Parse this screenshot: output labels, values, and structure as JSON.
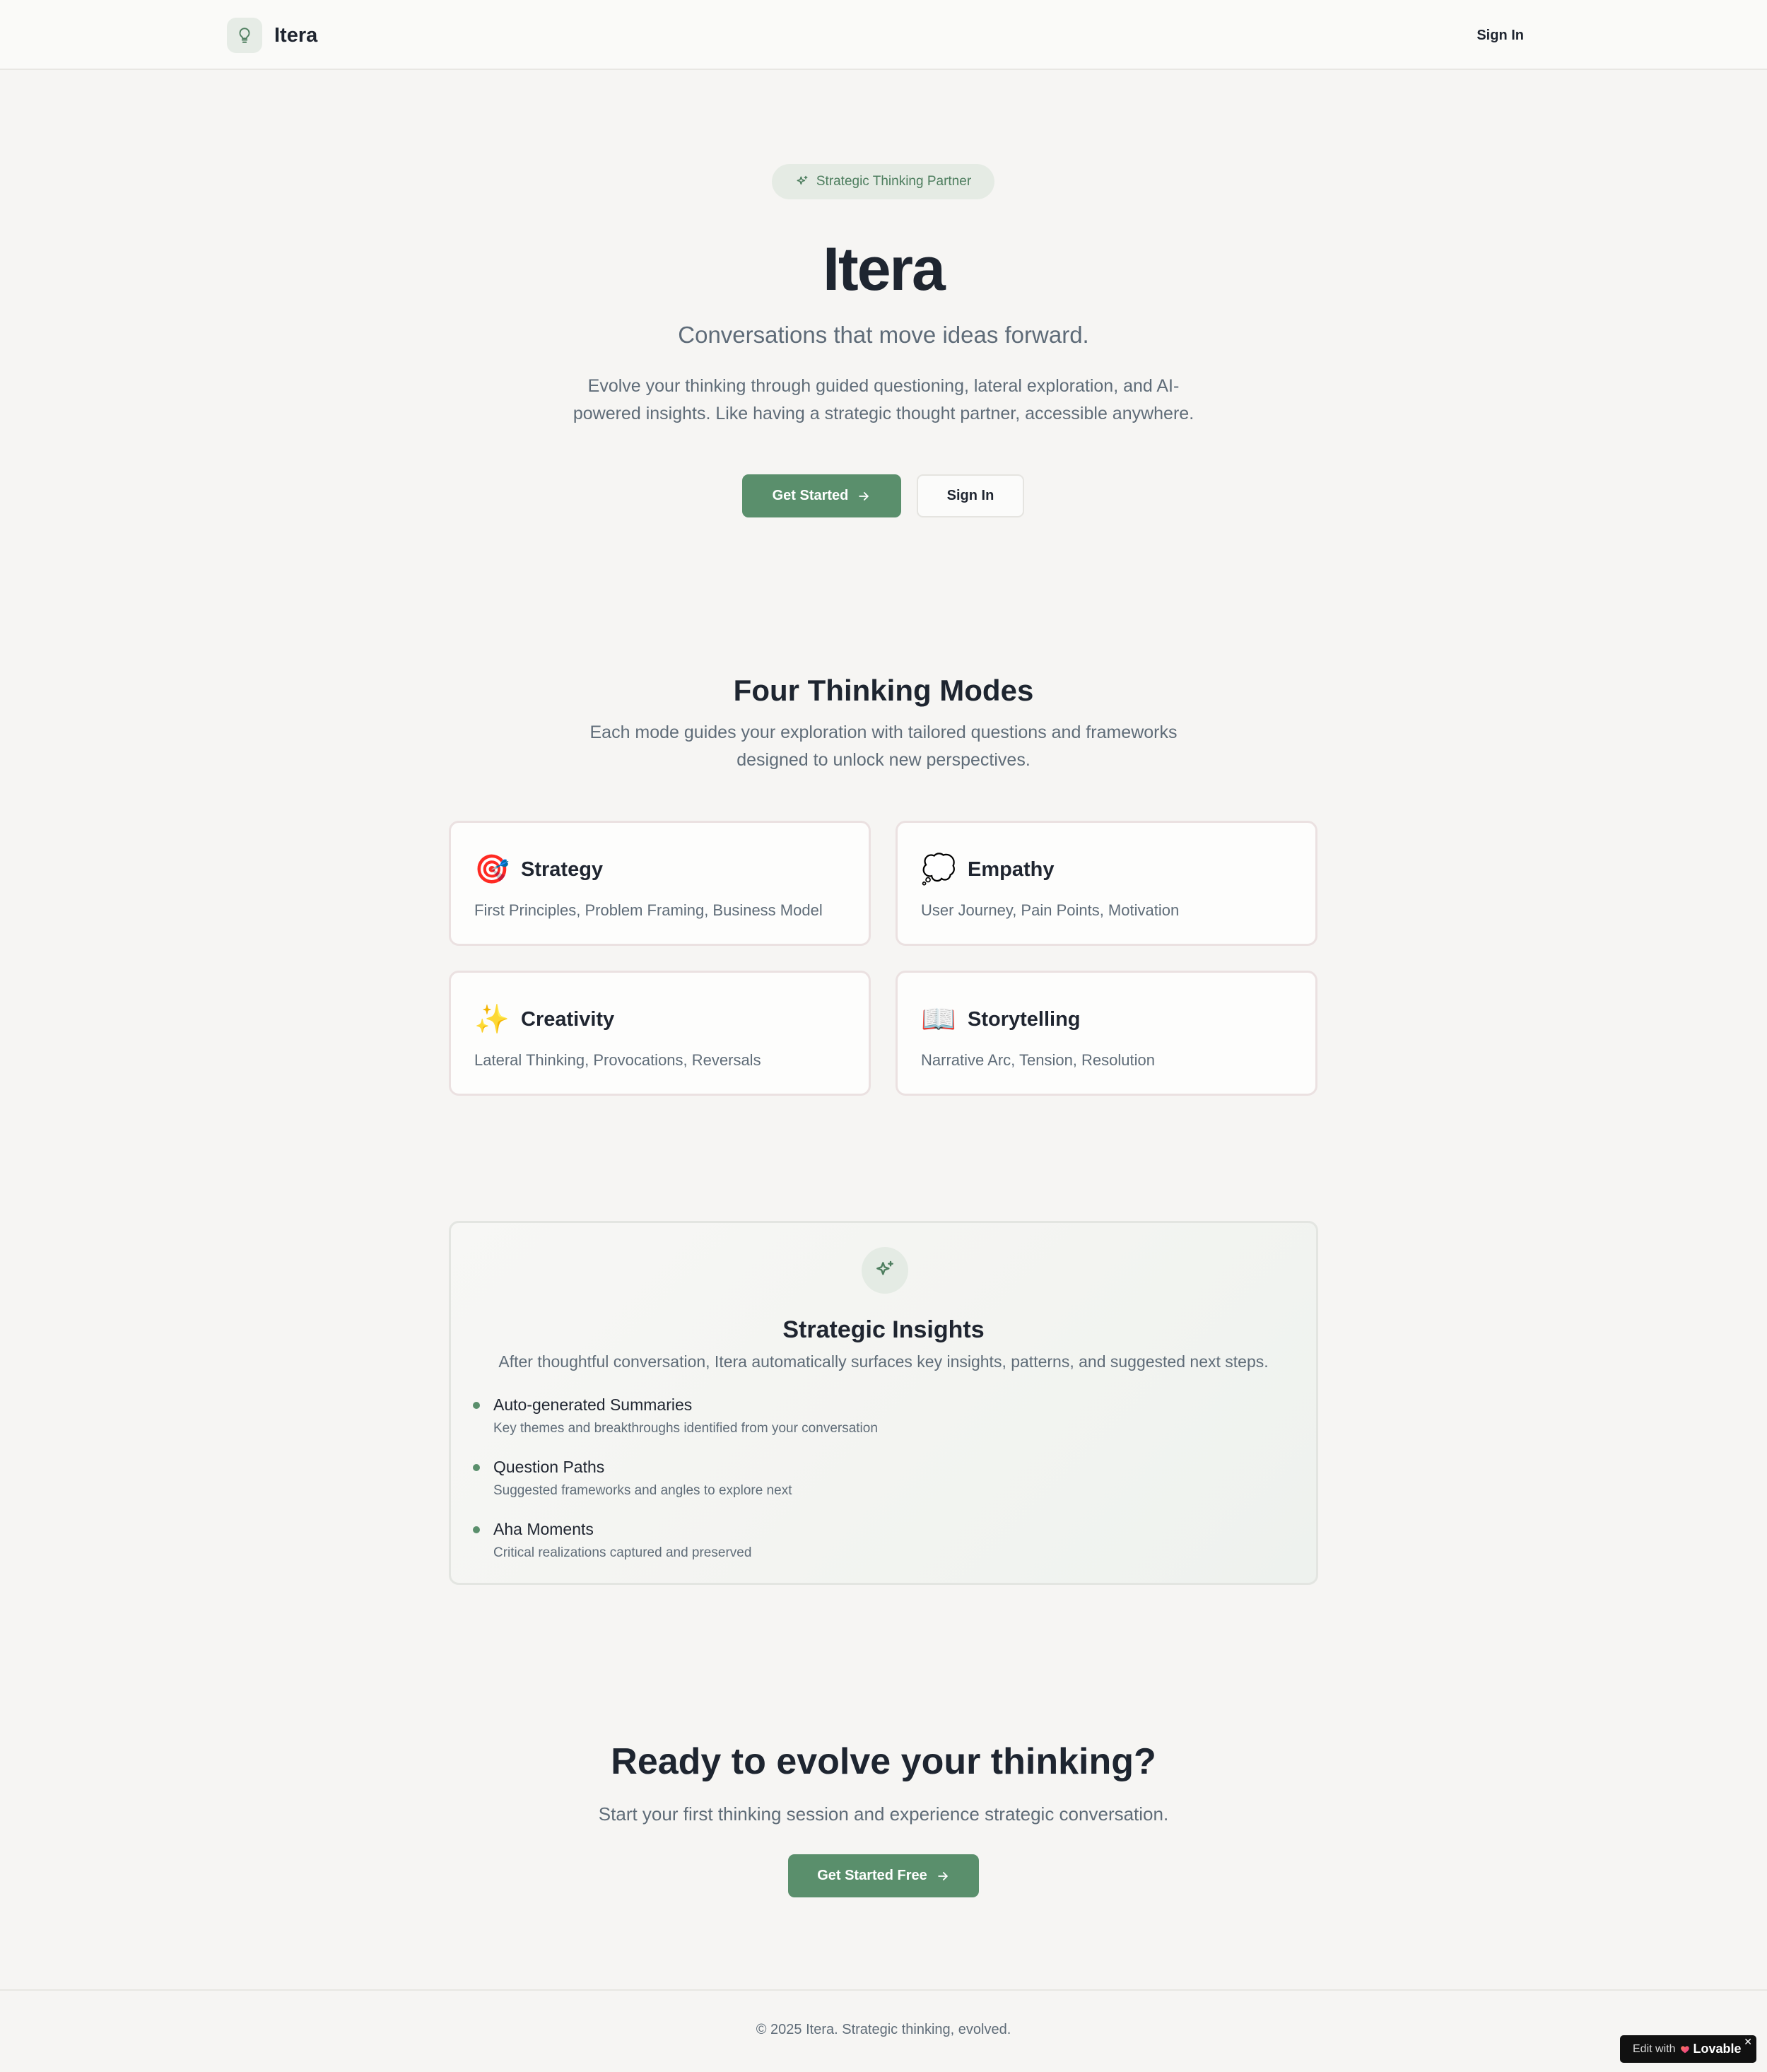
{
  "header": {
    "brand_name": "Itera",
    "logo_icon": "lightbulb-icon",
    "signin_label": "Sign In"
  },
  "hero": {
    "badge_label": "Strategic Thinking Partner",
    "badge_icon": "sparkles-icon",
    "title": "Itera",
    "subtitle": "Conversations that move ideas forward.",
    "description": "Evolve your thinking through guided questioning, lateral exploration, and AI-powered insights. Like having a strategic thought partner, accessible anywhere.",
    "primary_button": "Get Started",
    "secondary_button": "Sign In"
  },
  "modes": {
    "title": "Four Thinking Modes",
    "description": "Each mode guides your exploration with tailored questions and frameworks designed to unlock new perspectives.",
    "items": [
      {
        "icon": "🎯",
        "icon_name": "target-icon",
        "title": "Strategy",
        "tags": "First Principles, Problem Framing, Business Model"
      },
      {
        "icon": "💭",
        "icon_name": "thought-bubble-icon",
        "title": "Empathy",
        "tags": "User Journey, Pain Points, Motivation"
      },
      {
        "icon": "✨",
        "icon_name": "sparkles-icon",
        "title": "Creativity",
        "tags": "Lateral Thinking, Provocations, Reversals"
      },
      {
        "icon": "📖",
        "icon_name": "open-book-icon",
        "title": "Storytelling",
        "tags": "Narrative Arc, Tension, Resolution"
      }
    ]
  },
  "insights": {
    "icon": "sparkles-icon",
    "title": "Strategic Insights",
    "description": "After thoughtful conversation, Itera automatically surfaces key insights, patterns, and suggested next steps.",
    "items": [
      {
        "title": "Auto-generated Summaries",
        "description": "Key themes and breakthroughs identified from your conversation"
      },
      {
        "title": "Question Paths",
        "description": "Suggested frameworks and angles to explore next"
      },
      {
        "title": "Aha Moments",
        "description": "Critical realizations captured and preserved"
      }
    ]
  },
  "cta": {
    "title": "Ready to evolve your thinking?",
    "description": "Start your first thinking session and experience strategic conversation.",
    "button": "Get Started Free"
  },
  "footer": {
    "text": "© 2025 Itera. Strategic thinking, evolved."
  },
  "lovable_badge": {
    "edit_label": "Edit with",
    "brand": "Lovable",
    "close": "✕"
  },
  "colors": {
    "accent": "#5a8f6c",
    "background": "#f6f5f3",
    "text_primary": "#1f2530",
    "text_secondary": "#5f6c78"
  }
}
